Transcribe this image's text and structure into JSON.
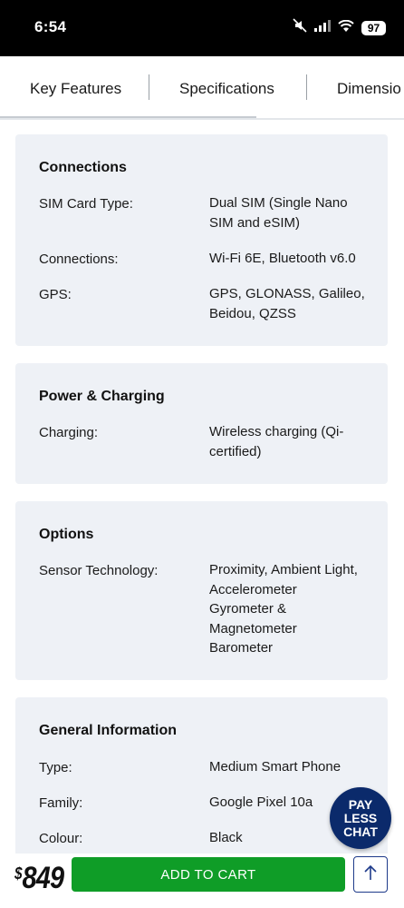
{
  "status_bar": {
    "time": "6:54",
    "battery": "97",
    "icons": [
      "mute-icon",
      "signal-icon",
      "wifi-icon",
      "battery-icon"
    ]
  },
  "tabs": [
    {
      "label": "Key Features"
    },
    {
      "label": "Specifications",
      "active": true
    },
    {
      "label": "Dimensio"
    }
  ],
  "sections": [
    {
      "title": "Connections",
      "rows": [
        {
          "label": "SIM Card Type:",
          "value": [
            "Dual SIM (Single Nano",
            "SIM and eSIM)"
          ]
        },
        {
          "label": "Connections:",
          "value": [
            "Wi-Fi 6E, Bluetooth v6.0"
          ]
        },
        {
          "label": "GPS:",
          "value": [
            "GPS, GLONASS, Galileo,",
            "Beidou, QZSS"
          ]
        }
      ]
    },
    {
      "title": "Power & Charging",
      "rows": [
        {
          "label": "Charging:",
          "value": [
            "Wireless charging (Qi-",
            "certified)"
          ]
        }
      ]
    },
    {
      "title": "Options",
      "rows": [
        {
          "label": "Sensor Technology:",
          "value": [
            "Proximity, Ambient Light,",
            "Accelerometer",
            "Gyrometer &",
            "Magnetometer",
            "Barometer"
          ]
        }
      ]
    },
    {
      "title": "General Information",
      "rows": [
        {
          "label": "Type:",
          "value": [
            "Medium Smart Phone"
          ]
        },
        {
          "label": "Family:",
          "value": [
            "Google Pixel 10a"
          ]
        },
        {
          "label": "Colour:",
          "value": [
            "Black"
          ]
        }
      ]
    }
  ],
  "chat_badge": {
    "line1": "PAY",
    "line2": "LESS",
    "line3": "CHAT"
  },
  "bottom_bar": {
    "currency": "$",
    "price": "849",
    "add_to_cart_label": "ADD TO CART"
  },
  "colors": {
    "cta_green": "#0f9d27",
    "chat_navy": "#0b2a6b",
    "card_bg": "#eef1f6"
  }
}
